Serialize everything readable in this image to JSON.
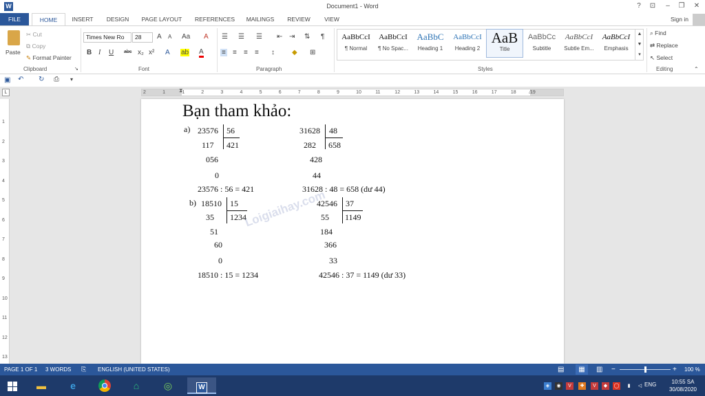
{
  "window": {
    "title": "Document1 - Word",
    "help": "?",
    "ribbon_display": "⊡",
    "minimize": "–",
    "restore": "❐",
    "close": "✕",
    "word_logo": "W"
  },
  "tabs": [
    "FILE",
    "HOME",
    "INSERT",
    "DESIGN",
    "PAGE LAYOUT",
    "REFERENCES",
    "MAILINGS",
    "REVIEW",
    "VIEW"
  ],
  "account": {
    "sign_in": "Sign in"
  },
  "clipboard": {
    "paste": "Paste",
    "cut": "Cut",
    "copy": "Copy",
    "format_painter": "Format Painter",
    "label": "Clipboard"
  },
  "font": {
    "name": "Times New Ro",
    "size": "28",
    "grow": "A",
    "shrink": "A",
    "case": "Aa",
    "clear": "A",
    "bold": "B",
    "italic": "I",
    "underline": "U",
    "strike": "abc",
    "subscript": "x₂",
    "superscript": "x²",
    "effects": "A",
    "highlight": "ab",
    "color": "A",
    "label": "Font"
  },
  "paragraph": {
    "label": "Paragraph",
    "pilcrow": "¶"
  },
  "styles": {
    "label": "Styles",
    "items": [
      {
        "sample": "AaBbCcI",
        "name": "¶ Normal"
      },
      {
        "sample": "AaBbCcI",
        "name": "¶ No Spac..."
      },
      {
        "sample": "AaBbC",
        "name": "Heading 1"
      },
      {
        "sample": "AaBbCcI",
        "name": "Heading 2"
      },
      {
        "sample": "AaB",
        "name": "Title"
      },
      {
        "sample": "AaBbCc",
        "name": "Subtitle"
      },
      {
        "sample": "AaBbCcI",
        "name": "Subtle Em..."
      },
      {
        "sample": "AaBbCcI",
        "name": "Emphasis"
      }
    ]
  },
  "editing": {
    "find": "Find",
    "replace": "Replace",
    "select": "Select",
    "label": "Editing"
  },
  "ruler": {
    "h_numbers": [
      "2",
      "1",
      "1",
      "2",
      "3",
      "4",
      "5",
      "6",
      "7",
      "8",
      "9",
      "10",
      "11",
      "12",
      "13",
      "14",
      "15",
      "16",
      "17",
      "18",
      "19"
    ],
    "v_numbers": [
      "1",
      "2",
      "3",
      "4",
      "5",
      "6",
      "7",
      "8",
      "9",
      "10",
      "11",
      "12",
      "13"
    ]
  },
  "document": {
    "heading": "Bạn tham khảo:",
    "part_a": "a)",
    "part_b": "b)",
    "div1": {
      "dividend": "23576",
      "divisor": "56",
      "quotient": "421",
      "steps": [
        "117",
        "056",
        "0"
      ],
      "result": "23576 : 56 = 421"
    },
    "div2": {
      "dividend": "31628",
      "divisor": "48",
      "quotient": "658",
      "steps": [
        "282",
        "428",
        "44"
      ],
      "result": "31628 : 48 = 658  (dư 44)"
    },
    "div3": {
      "dividend": "18510",
      "divisor": "15",
      "quotient": "1234",
      "steps": [
        "35",
        "51",
        "60",
        "0"
      ],
      "result": "18510 : 15 = 1234"
    },
    "div4": {
      "dividend": "42546",
      "divisor": "37",
      "quotient": "1149",
      "steps": [
        "55",
        "184",
        "366",
        "33"
      ],
      "result": "42546 : 37 = 1149  (dư 33)"
    },
    "watermark": "Loigiaihay.com"
  },
  "status": {
    "page": "PAGE 1 OF 1",
    "words": "3 WORDS",
    "language": "ENGLISH (UNITED STATES)",
    "zoom": "100 %",
    "zoom_level": 1.0
  },
  "taskbar": {
    "time": "10:55 SA",
    "date": "30/08/2020",
    "lang": "ENG"
  },
  "colors": {
    "accent": "#2b579a",
    "taskbar": "#1e3a6a"
  }
}
